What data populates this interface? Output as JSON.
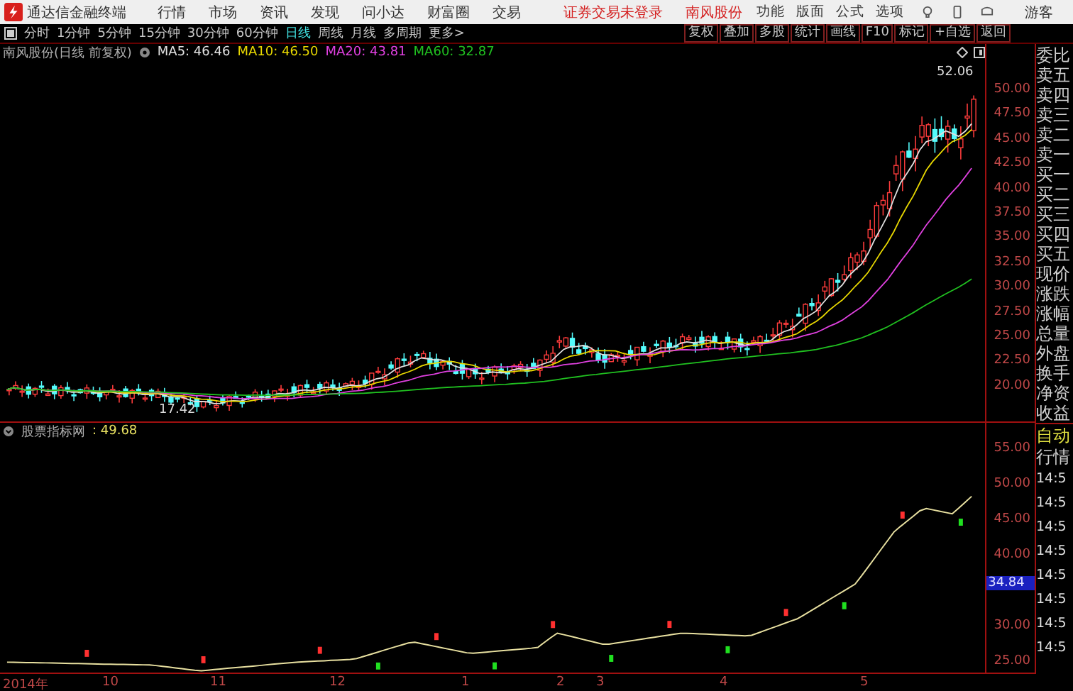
{
  "menu_bar": {
    "app_name": "通达信金融终端",
    "items": [
      "行情",
      "市场",
      "资讯",
      "发现",
      "问小达",
      "财富圈",
      "交易"
    ],
    "notices": [
      "证券交易未登录",
      "南风股份"
    ],
    "right_items": [
      "功能",
      "版面",
      "公式",
      "选项"
    ],
    "user": "游客"
  },
  "period_bar": {
    "periods": [
      {
        "label": "分时",
        "selected": false
      },
      {
        "label": "1分钟",
        "selected": false
      },
      {
        "label": "5分钟",
        "selected": false
      },
      {
        "label": "15分钟",
        "selected": false
      },
      {
        "label": "30分钟",
        "selected": false
      },
      {
        "label": "60分钟",
        "selected": false
      },
      {
        "label": "日线",
        "selected": true
      },
      {
        "label": "周线",
        "selected": false
      },
      {
        "label": "月线",
        "selected": false
      },
      {
        "label": "多周期",
        "selected": false
      },
      {
        "label": "更多>",
        "selected": false
      }
    ],
    "tools": [
      "复权",
      "叠加",
      "多股",
      "统计",
      "画线",
      "F10",
      "标记",
      "+自选",
      "返回"
    ]
  },
  "main_chart": {
    "title": "南风股份(日线 前复权)",
    "indicators": [
      {
        "label": "MA5: 46.46",
        "color": "#e0e0e0"
      },
      {
        "label": "MA10: 46.50",
        "color": "#e8d800"
      },
      {
        "label": "MA20: 43.81",
        "color": "#e040e0"
      },
      {
        "label": "MA60: 32.87",
        "color": "#20c020"
      }
    ],
    "high_label": "52.06",
    "low_label": "17.42",
    "price_ticks": [
      "50.00",
      "47.50",
      "45.00",
      "42.50",
      "40.00",
      "37.50",
      "35.00",
      "32.50",
      "30.00",
      "27.50",
      "25.00",
      "22.50",
      "20.00"
    ]
  },
  "indicator_pane": {
    "name": "股票指标网",
    "value": ": 49.68",
    "price_ticks": [
      "55.00",
      "50.00",
      "45.00",
      "40.00",
      "30.00",
      "25.00"
    ],
    "current_value": "34.84"
  },
  "x_axis": [
    "2014年",
    "10",
    "11",
    "12",
    "1",
    "2",
    "3",
    "4",
    "5"
  ],
  "quote_panel": {
    "labels": [
      "委比",
      "卖五",
      "卖四",
      "卖三",
      "卖二",
      "卖一",
      "买一",
      "买二",
      "买三",
      "买四",
      "买五",
      "现价",
      "涨跌",
      "涨幅",
      "总量",
      "外盘",
      "换手",
      "净资",
      "收益"
    ],
    "mode": "自动",
    "tab": "行情",
    "times": [
      "14:5",
      "14:5",
      "14:5",
      "14:5",
      "14:5",
      "14:5",
      "14:5",
      "14:5"
    ]
  }
}
